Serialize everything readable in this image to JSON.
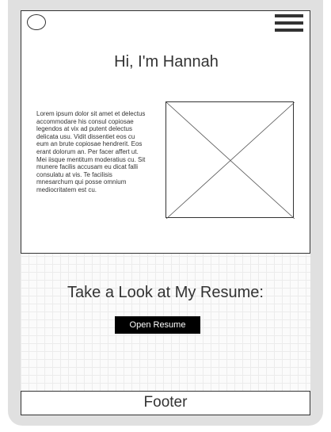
{
  "header": {
    "logo_icon": "circle-logo-icon",
    "menu_icon": "hamburger-menu-icon"
  },
  "hero": {
    "title": "Hi, I'm Hannah",
    "body": "Lorem ipsum dolor sit amet et delectus accommodare his consul copiosae legendos at vix ad putent delectus delicata usu. Vidit dissentiet eos cu eum an brute copiosae hendrerit. Eos erant dolorum an. Per facer affert ut. Mei iisque mentitum moderatius cu. Sit munere facilis accusam eu dicat falli consulatu at vis. Te facilisis mnesarchum qui posse omnium mediocritatem est cu.",
    "image_icon": "image-placeholder-icon"
  },
  "resume": {
    "title": "Take a Look at My Resume:",
    "button_label": "Open Resume"
  },
  "footer": {
    "label": "Footer"
  },
  "colors": {
    "frame": "#e0e0e0",
    "stroke": "#333333",
    "button_bg": "#000000",
    "button_text": "#ffffff"
  }
}
